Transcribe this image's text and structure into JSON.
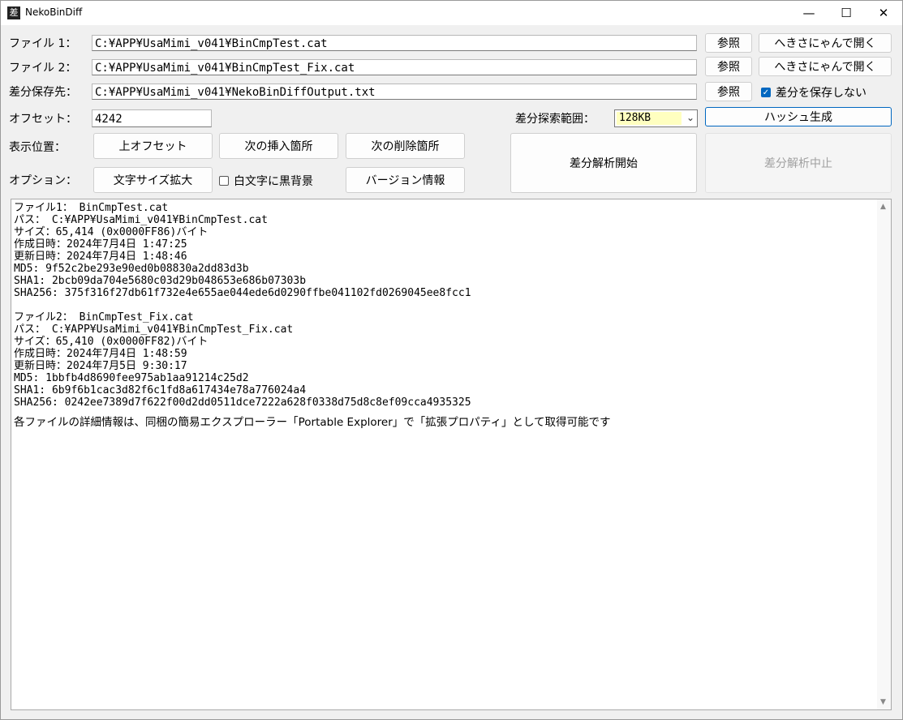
{
  "window": {
    "title": "NekoBinDiff",
    "icon_char": "差"
  },
  "controls": {
    "minimize": "—",
    "maximize": "☐",
    "close": "✕"
  },
  "rows": {
    "file1": {
      "label": "ファイル 1：",
      "path": "C:¥APP¥UsaMimi_v041¥BinCmpTest.cat",
      "browse": "参照",
      "open": "へきさにゃんで開く"
    },
    "file2": {
      "label": "ファイル 2：",
      "path": "C:¥APP¥UsaMimi_v041¥BinCmpTest_Fix.cat",
      "browse": "参照",
      "open": "へきさにゃんで開く"
    },
    "save": {
      "label": "差分保存先：",
      "path": "C:¥APP¥UsaMimi_v041¥NekoBinDiffOutput.txt",
      "browse": "参照",
      "nosave_label": "差分を保存しない",
      "nosave_checked": true
    },
    "offset": {
      "label": "オフセット：",
      "value": "4242"
    },
    "range": {
      "label": "差分探索範囲：",
      "value": "128KB"
    },
    "hash_button": "ハッシュ生成",
    "position": {
      "label": "表示位置：",
      "prev_offset": "上オフセット",
      "next_insert": "次の挿入箇所",
      "next_delete": "次の削除箇所"
    },
    "options": {
      "label": "オプション：",
      "font_enlarge": "文字サイズ拡大",
      "white_black_label": "白文字に黒背景",
      "white_black_checked": false,
      "version": "バージョン情報"
    },
    "start": "差分解析開始",
    "stop": "差分解析中止"
  },
  "output": {
    "file1_lines": [
      "ファイル1： BinCmpTest.cat",
      "パス： C:¥APP¥UsaMimi_v041¥BinCmpTest.cat",
      "サイズ：65,414 (0x0000FF86)バイト",
      "作成日時：2024年7月4日 1:47:25",
      "更新日時：2024年7月4日 1:48:46",
      "MD5: 9f52c2be293e90ed0b08830a2dd83d3b",
      "SHA1: 2bcb09da704e5680c03d29b048653e686b07303b",
      "SHA256: 375f316f27db61f732e4e655ae044ede6d0290ffbe041102fd0269045ee8fcc1"
    ],
    "file2_lines": [
      "ファイル2： BinCmpTest_Fix.cat",
      "パス： C:¥APP¥UsaMimi_v041¥BinCmpTest_Fix.cat",
      "サイズ：65,410 (0x0000FF82)バイト",
      "作成日時：2024年7月4日 1:48:59",
      "更新日時：2024年7月5日 9:30:17",
      "MD5: 1bbfb4d8690fee975ab1aa91214c25d2",
      "SHA1: 6b9f6b1cac3d82f6c1fd8a617434e78a776024a4",
      "SHA256: 0242ee7389d7f622f00d2dd0511dce7222a628f0338d75d8c8ef09cca4935325"
    ],
    "note": "各ファイルの詳細情報は、同梱の簡易エクスプローラー「Portable Explorer」で「拡張プロパティ」として取得可能です"
  },
  "scroll": {
    "up": "▲",
    "down": "▼"
  }
}
